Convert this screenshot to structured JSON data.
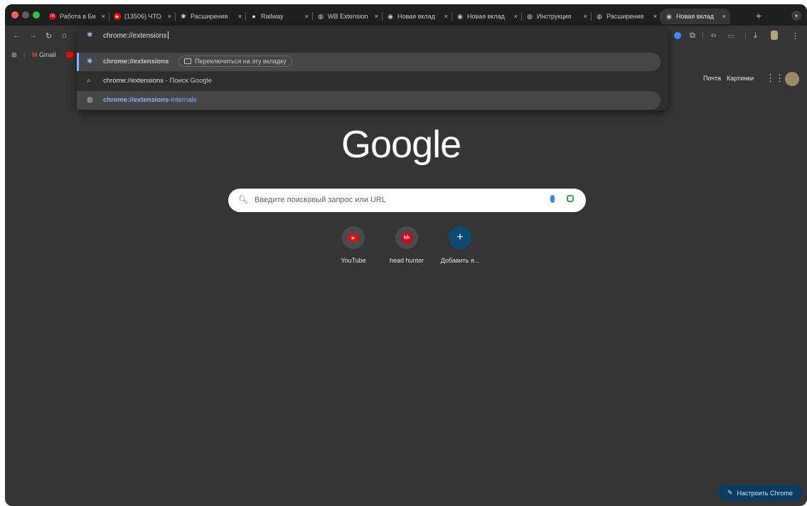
{
  "colors": {
    "window_bg": "#353535",
    "tabstrip_bg": "#1f1f1f",
    "accent_blue": "#8ab4f8",
    "customize_bg": "#0b3d63",
    "close": "#ff5f57",
    "minimize": "#5f5f5f",
    "maximize": "#28c840"
  },
  "tabs": [
    {
      "title": "Работа в Би",
      "icon": "hh-icon",
      "icon_color": "#d6001c"
    },
    {
      "title": "(13506) ЧТО",
      "icon": "youtube-icon",
      "icon_color": "#ff0000"
    },
    {
      "title": "Расширения",
      "icon": "puzzle-icon",
      "icon_color": "#c7c7c7"
    },
    {
      "title": "Railway",
      "icon": "railway-icon",
      "icon_color": "#e8e8e8"
    },
    {
      "title": "WB Extension",
      "icon": "globe-icon",
      "icon_color": "#c7c7c7"
    },
    {
      "title": "Новая вклад",
      "icon": "chrome-icon",
      "icon_color": "#c7c7c7"
    },
    {
      "title": "Новая вклад",
      "icon": "chrome-icon",
      "icon_color": "#c7c7c7"
    },
    {
      "title": "Инструкция",
      "icon": "globe-icon",
      "icon_color": "#c7c7c7"
    },
    {
      "title": "Расширения",
      "icon": "globe-icon",
      "icon_color": "#c7c7c7"
    },
    {
      "title": "Новая вклад",
      "icon": "chrome-icon",
      "icon_color": "#c7c7c7",
      "active": true
    }
  ],
  "tab_close": "×",
  "newtab_label": "+",
  "omnibox": {
    "text": "chrome://extensions",
    "suggestions": [
      {
        "icon": "puzzle-icon",
        "highlight": "chrome://extensions",
        "chip": "Переключиться на эту вкладку"
      },
      {
        "icon": "search-icon",
        "pre": "chrome://extensions",
        "rest": " - Поиск Google"
      },
      {
        "icon": "globe-icon",
        "highlight": "chrome://extensions",
        "rest": "-internals"
      }
    ]
  },
  "bookmarks": {
    "gmail": "Gmail"
  },
  "ntp": {
    "mail_link": "Почта",
    "images_link": "Картинки",
    "logo": "Google",
    "search_placeholder": "Введите поисковый запрос или URL",
    "shortcuts": [
      {
        "label": "YouTube",
        "icon": "youtube-icon"
      },
      {
        "label": "head hunter",
        "icon": "hh-icon",
        "glyph": "hh"
      },
      {
        "label": "Добавить я...",
        "icon": "plus-icon",
        "glyph": "+"
      }
    ],
    "customize": "Настроить Chrome"
  }
}
